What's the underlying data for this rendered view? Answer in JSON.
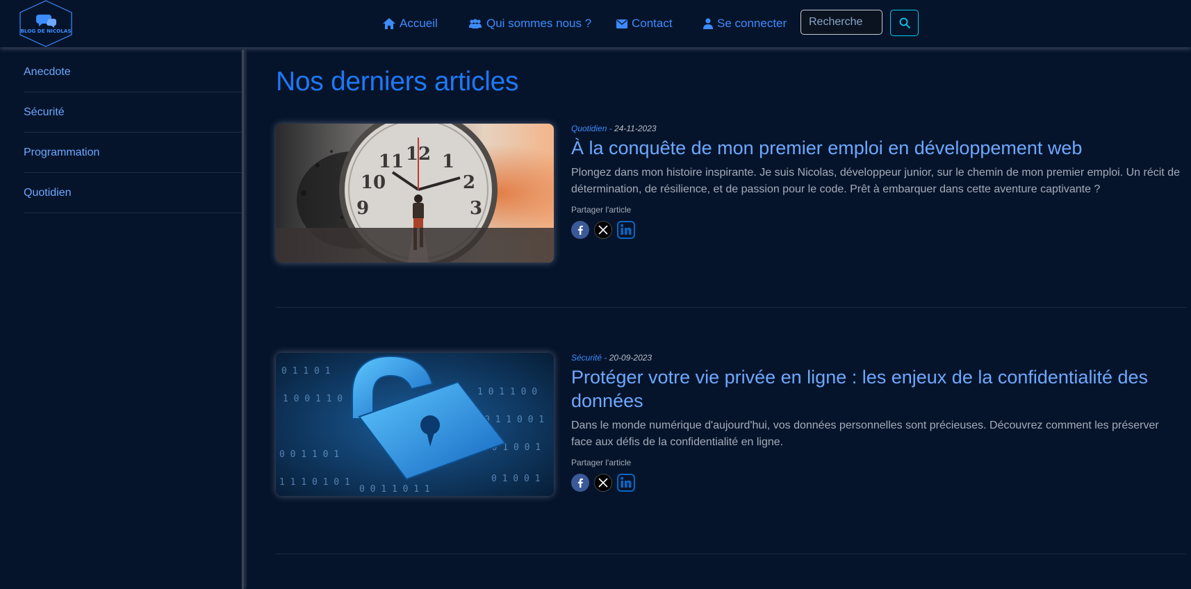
{
  "header": {
    "logo_text": "BLOG DE NICOLAS",
    "nav": [
      {
        "label": "Accueil",
        "icon": "home-icon"
      },
      {
        "label": "Qui sommes nous ?",
        "icon": "users-icon"
      },
      {
        "label": "Contact",
        "icon": "envelope-icon"
      },
      {
        "label": "Se connecter",
        "icon": "user-icon"
      }
    ],
    "search": {
      "placeholder": "Recherche",
      "button_icon": "search-icon"
    }
  },
  "sidebar": {
    "items": [
      {
        "label": "Anecdote"
      },
      {
        "label": "Sécurité"
      },
      {
        "label": "Programmation"
      },
      {
        "label": "Quotidien"
      }
    ]
  },
  "main": {
    "title": "Nos derniers articles",
    "articles": [
      {
        "category": "Quotidien",
        "separator": " - ",
        "date": "24-11-2023",
        "title": "À la conquête de mon premier emploi en développement web",
        "excerpt": "Plongez dans mon histoire inspirante. Je suis Nicolas, développeur junior, sur le chemin de mon premier emploi. Un récit de détermination, de résilience, et de passion pour le code. Prêt à embarquer dans cette aventure captivante ?",
        "share_label": "Partager l'article",
        "image": "stopwatch-runner-image"
      },
      {
        "category": "Sécurité",
        "separator": " - ",
        "date": "20-09-2023",
        "title": "Protéger votre vie privée en ligne : les enjeux de la confidentialité des données",
        "excerpt": "Dans le monde numérique d'aujourd'hui, vos données personnelles sont précieuses. Découvrez comment les préserver face aux défis de la confidentialité en ligne.",
        "share_label": "Partager l'article",
        "image": "padlock-binary-image"
      }
    ]
  },
  "colors": {
    "background": "#06142b",
    "accent": "#3d8bfd",
    "title": "#1f78f5",
    "link": "#6ea8fe",
    "search_border": "#0dcaf0"
  }
}
